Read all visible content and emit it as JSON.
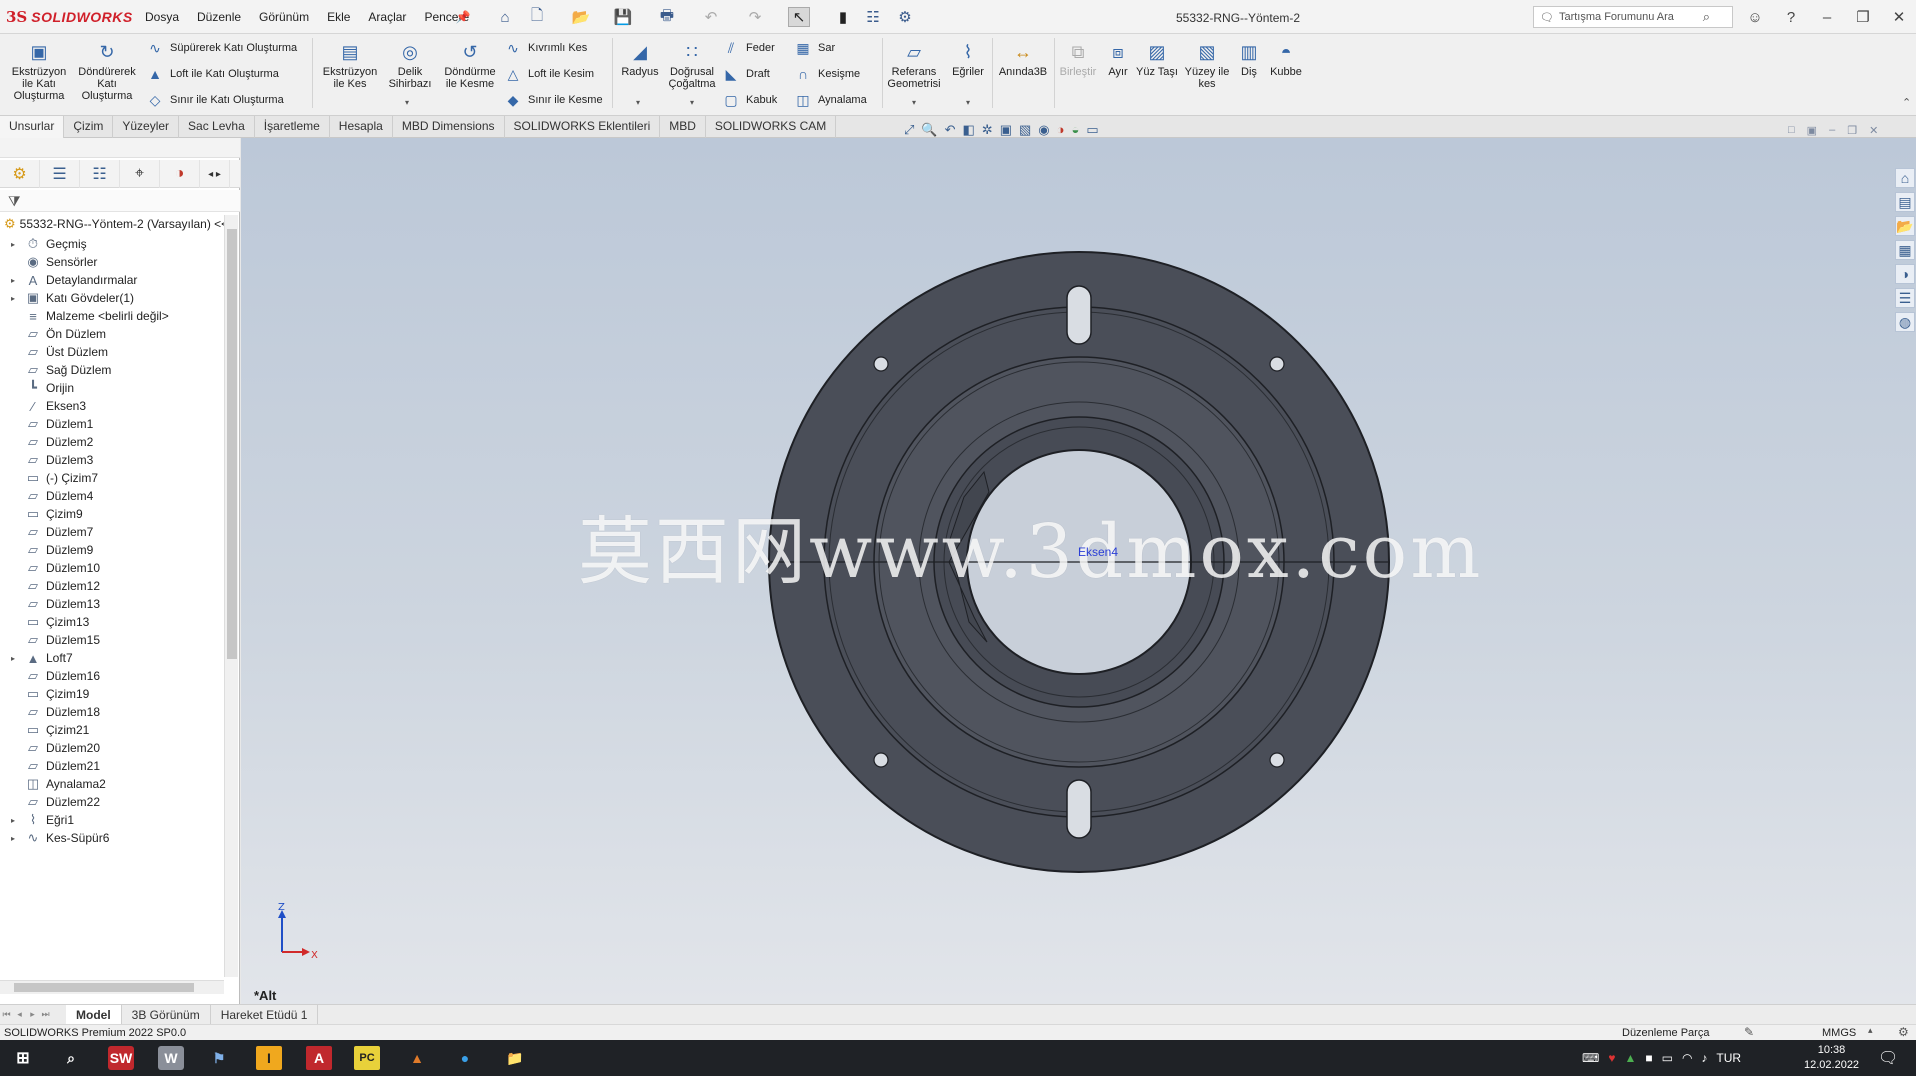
{
  "app": {
    "logo_ds": "3S",
    "logo_name": "SOLIDWORKS",
    "document_title": "55332-RNG--Yöntem-2",
    "menus": [
      "Dosya",
      "Düzenle",
      "Görünüm",
      "Ekle",
      "Araçlar",
      "Pencere"
    ],
    "search_placeholder": "Tartışma Forumunu Ara"
  },
  "command_manager": {
    "big": [
      {
        "label": "Ekstrüzyon ile Katı Oluşturma",
        "icon": "extrude-boss-icon"
      },
      {
        "label": "Döndürerek Katı Oluşturma",
        "icon": "revolve-boss-icon"
      },
      {
        "label": "Ekstrüzyon ile Kes",
        "icon": "extruded-cut-icon"
      },
      {
        "label": "Delik Sihirbazı",
        "icon": "hole-wizard-icon"
      },
      {
        "label": "Döndürme ile Kesme",
        "icon": "revolved-cut-icon"
      },
      {
        "label": "Radyus",
        "icon": "fillet-icon"
      },
      {
        "label": "Doğrusal Çoğaltma",
        "icon": "linear-pattern-icon"
      },
      {
        "label": "Referans Geometrisi",
        "icon": "reference-geometry-icon"
      },
      {
        "label": "Eğriler",
        "icon": "curves-icon"
      },
      {
        "label": "Anında3B",
        "icon": "instant3d-icon"
      },
      {
        "label": "Birleştir",
        "icon": "combine-icon",
        "disabled": true
      },
      {
        "label": "Ayır",
        "icon": "split-icon"
      },
      {
        "label": "Yüz Taşı",
        "icon": "move-face-icon"
      },
      {
        "label": "Yüzey ile kes",
        "icon": "cut-with-surface-icon"
      },
      {
        "label": "Diş",
        "icon": "thread-icon"
      },
      {
        "label": "Kubbe",
        "icon": "dome-icon"
      }
    ],
    "small": [
      {
        "label": "Süpürerek Katı Oluşturma",
        "icon": "swept-boss-icon"
      },
      {
        "label": "Loft ile Katı Oluşturma",
        "icon": "lofted-boss-icon"
      },
      {
        "label": "Sınır ile Katı Oluşturma",
        "icon": "boundary-boss-icon"
      },
      {
        "label": "Kıvrımlı Kes",
        "icon": "swept-cut-icon"
      },
      {
        "label": "Loft ile Kesim",
        "icon": "lofted-cut-icon"
      },
      {
        "label": "Sınır ile Kesme",
        "icon": "boundary-cut-icon"
      },
      {
        "label": "Feder",
        "icon": "rib-icon"
      },
      {
        "label": "Draft",
        "icon": "draft-icon"
      },
      {
        "label": "Kabuk",
        "icon": "shell-icon"
      },
      {
        "label": "Sar",
        "icon": "wrap-icon"
      },
      {
        "label": "Kesişme",
        "icon": "intersect-icon"
      },
      {
        "label": "Aynalama",
        "icon": "mirror-icon"
      }
    ]
  },
  "tabs": [
    "Unsurlar",
    "Çizim",
    "Yüzeyler",
    "Sac Levha",
    "İşaretleme",
    "Hesapla",
    "MBD Dimensions",
    "SOLIDWORKS Eklentileri",
    "MBD",
    "SOLIDWORKS CAM"
  ],
  "feature_tree": {
    "root": "55332-RNG--Yöntem-2 (Varsayılan) <<",
    "items": [
      {
        "label": "Geçmiş",
        "expandable": true,
        "icon": "history-icon"
      },
      {
        "label": "Sensörler",
        "expandable": false,
        "icon": "sensor-icon"
      },
      {
        "label": "Detaylandırmalar",
        "expandable": true,
        "icon": "annotations-icon"
      },
      {
        "label": "Katı Gövdeler(1)",
        "expandable": true,
        "icon": "solid-bodies-icon"
      },
      {
        "label": "Malzeme <belirli değil>",
        "expandable": false,
        "icon": "material-icon"
      },
      {
        "label": "Ön Düzlem",
        "expandable": false,
        "icon": "plane-icon"
      },
      {
        "label": "Üst Düzlem",
        "expandable": false,
        "icon": "plane-icon"
      },
      {
        "label": "Sağ Düzlem",
        "expandable": false,
        "icon": "plane-icon"
      },
      {
        "label": "Orijin",
        "expandable": false,
        "icon": "origin-icon"
      },
      {
        "label": "Eksen3",
        "expandable": false,
        "icon": "axis-icon"
      },
      {
        "label": "Düzlem1",
        "expandable": false,
        "icon": "plane-icon"
      },
      {
        "label": "Düzlem2",
        "expandable": false,
        "icon": "plane-icon"
      },
      {
        "label": "Düzlem3",
        "expandable": false,
        "icon": "plane-icon"
      },
      {
        "label": "(-) Çizim7",
        "expandable": false,
        "icon": "sketch-icon"
      },
      {
        "label": "Düzlem4",
        "expandable": false,
        "icon": "plane-icon"
      },
      {
        "label": "Çizim9",
        "expandable": false,
        "icon": "sketch-icon"
      },
      {
        "label": "Düzlem7",
        "expandable": false,
        "icon": "plane-icon"
      },
      {
        "label": "Düzlem9",
        "expandable": false,
        "icon": "plane-icon"
      },
      {
        "label": "Düzlem10",
        "expandable": false,
        "icon": "plane-icon"
      },
      {
        "label": "Düzlem12",
        "expandable": false,
        "icon": "plane-icon"
      },
      {
        "label": "Düzlem13",
        "expandable": false,
        "icon": "plane-icon"
      },
      {
        "label": "Çizim13",
        "expandable": false,
        "icon": "sketch-icon"
      },
      {
        "label": "Düzlem15",
        "expandable": false,
        "icon": "plane-icon"
      },
      {
        "label": "Loft7",
        "expandable": true,
        "icon": "loft-icon"
      },
      {
        "label": "Düzlem16",
        "expandable": false,
        "icon": "plane-icon"
      },
      {
        "label": "Çizim19",
        "expandable": false,
        "icon": "sketch-icon"
      },
      {
        "label": "Düzlem18",
        "expandable": false,
        "icon": "plane-icon"
      },
      {
        "label": "Çizim21",
        "expandable": false,
        "icon": "sketch-icon"
      },
      {
        "label": "Düzlem20",
        "expandable": false,
        "icon": "plane-icon"
      },
      {
        "label": "Düzlem21",
        "expandable": false,
        "icon": "plane-icon"
      },
      {
        "label": "Aynalama2",
        "expandable": false,
        "icon": "mirror-icon"
      },
      {
        "label": "Düzlem22",
        "expandable": false,
        "icon": "plane-icon"
      },
      {
        "label": "Eğri1",
        "expandable": true,
        "icon": "curve-icon"
      },
      {
        "label": "Kes-Süpür6",
        "expandable": true,
        "icon": "swept-cut-icon"
      }
    ]
  },
  "viewport": {
    "view_name": "*Alt",
    "watermark": "莫西网www.3dmox.com",
    "edge_label": "Eksen4",
    "triad_x": "X",
    "triad_z": "Z",
    "part_color": "#4a4e58"
  },
  "bottom_tabs": [
    "Model",
    "3B Görünüm",
    "Hareket Etüdü 1"
  ],
  "status": {
    "left": "SOLIDWORKS Premium 2022 SP0.0",
    "mode": "Düzenleme Parça",
    "units": "MMGS"
  },
  "taskbar": {
    "lang": "TUR",
    "time": "10:38",
    "date": "12.02.2022"
  }
}
